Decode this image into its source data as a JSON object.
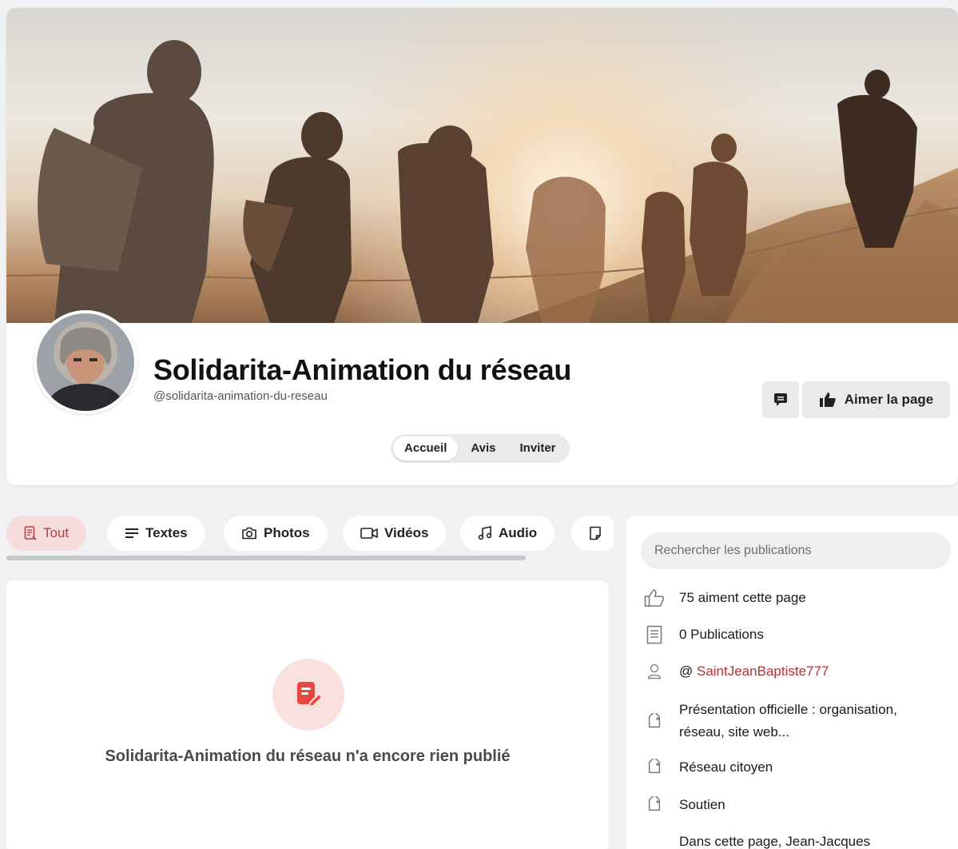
{
  "page": {
    "title": "Solidarita-Animation du réseau",
    "handle": "@solidarita-animation-du-reseau"
  },
  "actions": {
    "message_icon": "message-icon",
    "like_label": "Aimer la page"
  },
  "page_tabs": [
    {
      "label": "Accueil",
      "active": true
    },
    {
      "label": "Avis",
      "active": false
    },
    {
      "label": "Inviter",
      "active": false
    }
  ],
  "filters": [
    {
      "label": "Tout",
      "icon": "document-icon",
      "active": true
    },
    {
      "label": "Textes",
      "icon": "text-lines-icon",
      "active": false
    },
    {
      "label": "Photos",
      "icon": "camera-icon",
      "active": false
    },
    {
      "label": "Vidéos",
      "icon": "video-icon",
      "active": false
    },
    {
      "label": "Audio",
      "icon": "music-icon",
      "active": false
    },
    {
      "label": "",
      "icon": "note-icon",
      "active": false
    }
  ],
  "feed": {
    "empty_message": "Solidarita-Animation du réseau n'a encore rien publié"
  },
  "sidebar": {
    "search_placeholder": "Rechercher les publications",
    "likes": "75 aiment cette page",
    "publications": "0 Publications",
    "owner_prefix": "@ ",
    "owner_link": "SaintJeanBaptiste777",
    "category": "Présentation officielle : organisation, réseau, site web...",
    "tag1": "Réseau citoyen",
    "tag2": "Soutien",
    "description_start": "Dans cette page, Jean-Jacques"
  },
  "colors": {
    "accent": "#c0393b",
    "accent_bg": "#f6dcdc",
    "button_bg": "#e9eaec",
    "page_bg": "#f0f1f3"
  }
}
